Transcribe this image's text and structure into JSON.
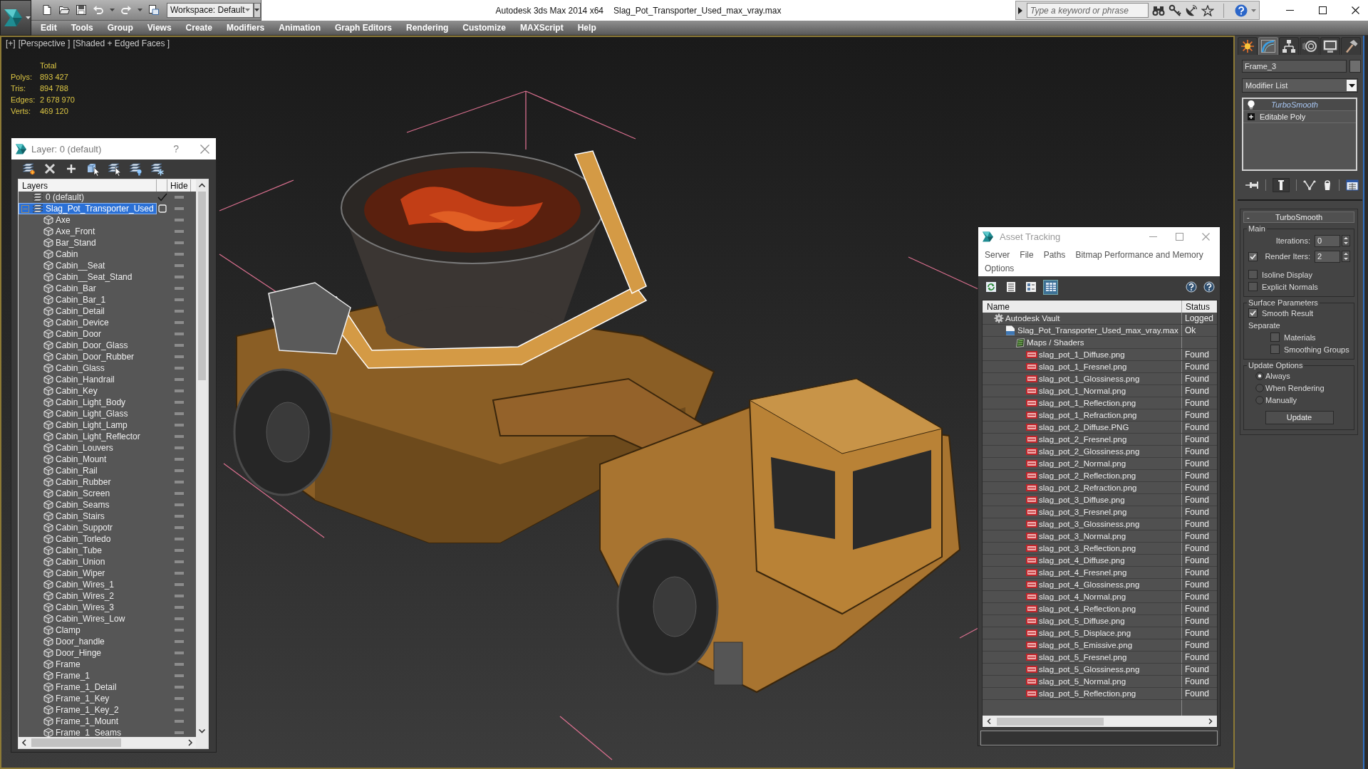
{
  "title_bar": {
    "workspace": "Workspace: Default",
    "app_title": "Autodesk 3ds Max 2014 x64",
    "file_title": "Slag_Pot_Transporter_Used_max_vray.max",
    "search": {
      "placeholder": "Type a keyword or phrase"
    }
  },
  "menu": [
    "Edit",
    "Tools",
    "Group",
    "Views",
    "Create",
    "Modifiers",
    "Animation",
    "Graph Editors",
    "Rendering",
    "Customize",
    "MAXScript",
    "Help"
  ],
  "viewport": {
    "labels": [
      "[+]",
      "[Perspective ]",
      "[Shaded + Edged Faces ]"
    ],
    "stats": {
      "heading": "Total",
      "rows": [
        {
          "label": "Polys:",
          "value": "893 427"
        },
        {
          "label": "Tris:",
          "value": "894 788"
        },
        {
          "label": "Edges:",
          "value": "2 678 970"
        },
        {
          "label": "Verts:",
          "value": "469 120"
        }
      ]
    }
  },
  "layer_explorer": {
    "title": "Layer: 0 (default)",
    "help": "?",
    "columns": [
      "Layers",
      "Hide"
    ],
    "layers": [
      {
        "kind": "layer",
        "name": "0 (default)",
        "current": true,
        "selected": false,
        "hidden": false
      },
      {
        "kind": "layer",
        "name": "Slag_Pot_Transporter_Used",
        "current": false,
        "selected": true,
        "expanded": true,
        "hidden": false,
        "children": [
          {
            "kind": "object",
            "name": "Axe",
            "selected": false,
            "hidden": false
          },
          {
            "kind": "object",
            "name": "Axe_Front",
            "selected": false,
            "hidden": false
          },
          {
            "kind": "object",
            "name": "Bar_Stand",
            "selected": false,
            "hidden": false
          },
          {
            "kind": "object",
            "name": "Cabin",
            "selected": false,
            "hidden": false
          },
          {
            "kind": "object",
            "name": "Cabin__Seat",
            "selected": false,
            "hidden": false
          },
          {
            "kind": "object",
            "name": "Cabin__Seat_Stand",
            "selected": false,
            "hidden": false
          },
          {
            "kind": "object",
            "name": "Cabin_Bar",
            "selected": false,
            "hidden": false
          },
          {
            "kind": "object",
            "name": "Cabin_Bar_1",
            "selected": false,
            "hidden": false
          },
          {
            "kind": "object",
            "name": "Cabin_Detail",
            "selected": false,
            "hidden": false
          },
          {
            "kind": "object",
            "name": "Cabin_Device",
            "selected": false,
            "hidden": false
          },
          {
            "kind": "object",
            "name": "Cabin_Door",
            "selected": false,
            "hidden": false
          },
          {
            "kind": "object",
            "name": "Cabin_Door_Glass",
            "selected": false,
            "hidden": false
          },
          {
            "kind": "object",
            "name": "Cabin_Door_Rubber",
            "selected": false,
            "hidden": false
          },
          {
            "kind": "object",
            "name": "Cabin_Glass",
            "selected": false,
            "hidden": false
          },
          {
            "kind": "object",
            "name": "Cabin_Handrail",
            "selected": false,
            "hidden": false
          },
          {
            "kind": "object",
            "name": "Cabin_Key",
            "selected": false,
            "hidden": false
          },
          {
            "kind": "object",
            "name": "Cabin_Light_Body",
            "selected": false,
            "hidden": false
          },
          {
            "kind": "object",
            "name": "Cabin_Light_Glass",
            "selected": false,
            "hidden": false
          },
          {
            "kind": "object",
            "name": "Cabin_Light_Lamp",
            "selected": false,
            "hidden": false
          },
          {
            "kind": "object",
            "name": "Cabin_Light_Reflector",
            "selected": false,
            "hidden": false
          },
          {
            "kind": "object",
            "name": "Cabin_Louvers",
            "selected": false,
            "hidden": false
          },
          {
            "kind": "object",
            "name": "Cabin_Mount",
            "selected": false,
            "hidden": false
          },
          {
            "kind": "object",
            "name": "Cabin_Rail",
            "selected": false,
            "hidden": false
          },
          {
            "kind": "object",
            "name": "Cabin_Rubber",
            "selected": false,
            "hidden": false
          },
          {
            "kind": "object",
            "name": "Cabin_Screen",
            "selected": false,
            "hidden": false
          },
          {
            "kind": "object",
            "name": "Cabin_Seams",
            "selected": false,
            "hidden": false
          },
          {
            "kind": "object",
            "name": "Cabin_Stairs",
            "selected": false,
            "hidden": false
          },
          {
            "kind": "object",
            "name": "Cabin_Suppotr",
            "selected": false,
            "hidden": false
          },
          {
            "kind": "object",
            "name": "Cabin_Torledo",
            "selected": false,
            "hidden": false
          },
          {
            "kind": "object",
            "name": "Cabin_Tube",
            "selected": false,
            "hidden": false
          },
          {
            "kind": "object",
            "name": "Cabin_Union",
            "selected": false,
            "hidden": false
          },
          {
            "kind": "object",
            "name": "Cabin_Wiper",
            "selected": false,
            "hidden": false
          },
          {
            "kind": "object",
            "name": "Cabin_Wires_1",
            "selected": false,
            "hidden": false
          },
          {
            "kind": "object",
            "name": "Cabin_Wires_2",
            "selected": false,
            "hidden": false
          },
          {
            "kind": "object",
            "name": "Cabin_Wires_3",
            "selected": false,
            "hidden": false
          },
          {
            "kind": "object",
            "name": "Cabin_Wires_Low",
            "selected": false,
            "hidden": false
          },
          {
            "kind": "object",
            "name": "Clamp",
            "selected": false,
            "hidden": false
          },
          {
            "kind": "object",
            "name": "Door_handle",
            "selected": false,
            "hidden": false
          },
          {
            "kind": "object",
            "name": "Door_Hinge",
            "selected": false,
            "hidden": false
          },
          {
            "kind": "object",
            "name": "Frame",
            "selected": false,
            "hidden": false
          },
          {
            "kind": "object",
            "name": "Frame_1",
            "selected": false,
            "hidden": false
          },
          {
            "kind": "object",
            "name": "Frame_1_Detail",
            "selected": false,
            "hidden": false
          },
          {
            "kind": "object",
            "name": "Frame_1_Key",
            "selected": false,
            "hidden": false
          },
          {
            "kind": "object",
            "name": "Frame_1_Key_2",
            "selected": false,
            "hidden": false
          },
          {
            "kind": "object",
            "name": "Frame_1_Mount",
            "selected": false,
            "hidden": false
          },
          {
            "kind": "object",
            "name": "Frame_1_Seams",
            "selected": false,
            "hidden": false
          }
        ]
      }
    ]
  },
  "asset_tracking": {
    "title": "Asset Tracking",
    "menu": [
      "Server",
      "File",
      "Paths",
      "Bitmap Performance and Memory",
      "Options"
    ],
    "toolbar": [
      {
        "kind": "refresh",
        "selected": false
      },
      {
        "kind": "list",
        "selected": false
      },
      {
        "kind": "thumbnails",
        "selected": false
      },
      {
        "kind": "table",
        "selected": true
      }
    ],
    "columns": [
      "Name",
      "Status"
    ],
    "assets": [
      {
        "kind": "vault",
        "name": "Autodesk Vault",
        "status": "Logged",
        "selected": false,
        "children": [
          {
            "kind": "max",
            "name": "Slag_Pot_Transporter_Used_max_vray.max",
            "status": "Ok",
            "selected": false,
            "children": [
              {
                "kind": "folder",
                "name": "Maps / Shaders",
                "selected": false,
                "children": [
                  {
                    "kind": "png",
                    "name": "slag_pot_1_Diffuse.png",
                    "status": "Found",
                    "selected": false
                  },
                  {
                    "kind": "png",
                    "name": "slag_pot_1_Fresnel.png",
                    "status": "Found",
                    "selected": false
                  },
                  {
                    "kind": "png",
                    "name": "slag_pot_1_Glossiness.png",
                    "status": "Found",
                    "selected": false
                  },
                  {
                    "kind": "png",
                    "name": "slag_pot_1_Normal.png",
                    "status": "Found",
                    "selected": false
                  },
                  {
                    "kind": "png",
                    "name": "slag_pot_1_Reflection.png",
                    "status": "Found",
                    "selected": false
                  },
                  {
                    "kind": "png",
                    "name": "slag_pot_1_Refraction.png",
                    "status": "Found",
                    "selected": false
                  },
                  {
                    "kind": "png",
                    "name": "slag_pot_2_Diffuse.PNG",
                    "status": "Found",
                    "selected": false
                  },
                  {
                    "kind": "png",
                    "name": "slag_pot_2_Fresnel.png",
                    "status": "Found",
                    "selected": false
                  },
                  {
                    "kind": "png",
                    "name": "slag_pot_2_Glossiness.png",
                    "status": "Found",
                    "selected": false
                  },
                  {
                    "kind": "png",
                    "name": "slag_pot_2_Normal.png",
                    "status": "Found",
                    "selected": false
                  },
                  {
                    "kind": "png",
                    "name": "slag_pot_2_Reflection.png",
                    "status": "Found",
                    "selected": false
                  },
                  {
                    "kind": "png",
                    "name": "slag_pot_2_Refraction.png",
                    "status": "Found",
                    "selected": false
                  },
                  {
                    "kind": "png",
                    "name": "slag_pot_3_Diffuse.png",
                    "status": "Found",
                    "selected": false
                  },
                  {
                    "kind": "png",
                    "name": "slag_pot_3_Fresnel.png",
                    "status": "Found",
                    "selected": false
                  },
                  {
                    "kind": "png",
                    "name": "slag_pot_3_Glossiness.png",
                    "status": "Found",
                    "selected": false
                  },
                  {
                    "kind": "png",
                    "name": "slag_pot_3_Normal.png",
                    "status": "Found",
                    "selected": false
                  },
                  {
                    "kind": "png",
                    "name": "slag_pot_3_Reflection.png",
                    "status": "Found",
                    "selected": false
                  },
                  {
                    "kind": "png",
                    "name": "slag_pot_4_Diffuse.png",
                    "status": "Found",
                    "selected": false
                  },
                  {
                    "kind": "png",
                    "name": "slag_pot_4_Fresnel.png",
                    "status": "Found",
                    "selected": false
                  },
                  {
                    "kind": "png",
                    "name": "slag_pot_4_Glossiness.png",
                    "status": "Found",
                    "selected": false
                  },
                  {
                    "kind": "png",
                    "name": "slag_pot_4_Normal.png",
                    "status": "Found",
                    "selected": false
                  },
                  {
                    "kind": "png",
                    "name": "slag_pot_4_Reflection.png",
                    "status": "Found",
                    "selected": false
                  },
                  {
                    "kind": "png",
                    "name": "slag_pot_5_Diffuse.png",
                    "status": "Found",
                    "selected": false
                  },
                  {
                    "kind": "png",
                    "name": "slag_pot_5_Displace.png",
                    "status": "Found",
                    "selected": false
                  },
                  {
                    "kind": "png",
                    "name": "slag_pot_5_Emissive.png",
                    "status": "Found",
                    "selected": false
                  },
                  {
                    "kind": "png",
                    "name": "slag_pot_5_Fresnel.png",
                    "status": "Found",
                    "selected": false
                  },
                  {
                    "kind": "png",
                    "name": "slag_pot_5_Glossiness.png",
                    "status": "Found",
                    "selected": false
                  },
                  {
                    "kind": "png",
                    "name": "slag_pot_5_Normal.png",
                    "status": "Found",
                    "selected": false
                  },
                  {
                    "kind": "png",
                    "name": "slag_pot_5_Reflection.png",
                    "status": "Found",
                    "selected": false
                  }
                ]
              }
            ]
          }
        ]
      }
    ]
  },
  "command_panel": {
    "tabs": [
      {
        "kind": "create",
        "selected": false
      },
      {
        "kind": "modify",
        "selected": true
      },
      {
        "kind": "hierarchy",
        "selected": false
      },
      {
        "kind": "motion",
        "selected": false
      },
      {
        "kind": "display",
        "selected": false
      },
      {
        "kind": "utilities",
        "selected": false
      }
    ],
    "object_name": "Frame_3",
    "modifier_list": "Modifier List",
    "stack": [
      {
        "kind": "modifier",
        "name": "TurboSmooth",
        "selected": true
      },
      {
        "kind": "base",
        "name": "Editable Poly",
        "selected": false,
        "expanded": false
      }
    ],
    "rollout": {
      "collapse": "-",
      "title": "TurboSmooth",
      "groups": [
        {
          "title": "Main",
          "controls": [
            {
              "kind": "spinner",
              "label": "Iterations:",
              "value": "0"
            },
            {
              "kind": "check_spinner",
              "label": "Render Iters:",
              "value": "2",
              "checked": true
            },
            {
              "kind": "checkbox",
              "label": "Isoline Display",
              "checked": false
            },
            {
              "kind": "checkbox",
              "label": "Explicit Normals",
              "checked": false
            }
          ]
        },
        {
          "title": "Surface Parameters",
          "controls": [
            {
              "kind": "checkbox",
              "label": "Smooth Result",
              "checked": true
            },
            {
              "kind": "label",
              "label": "Separate"
            },
            {
              "kind": "subcheckbox",
              "label": "Materials",
              "checked": false
            },
            {
              "kind": "subcheckbox",
              "label": "Smoothing Groups",
              "checked": false
            }
          ]
        },
        {
          "title": "Update Options",
          "controls": [
            {
              "kind": "radio",
              "label": "Always",
              "selected": true
            },
            {
              "kind": "radio",
              "label": "When Rendering",
              "selected": false
            },
            {
              "kind": "radio",
              "label": "Manually",
              "selected": false
            },
            {
              "kind": "button",
              "label": "Update"
            }
          ]
        }
      ]
    }
  }
}
